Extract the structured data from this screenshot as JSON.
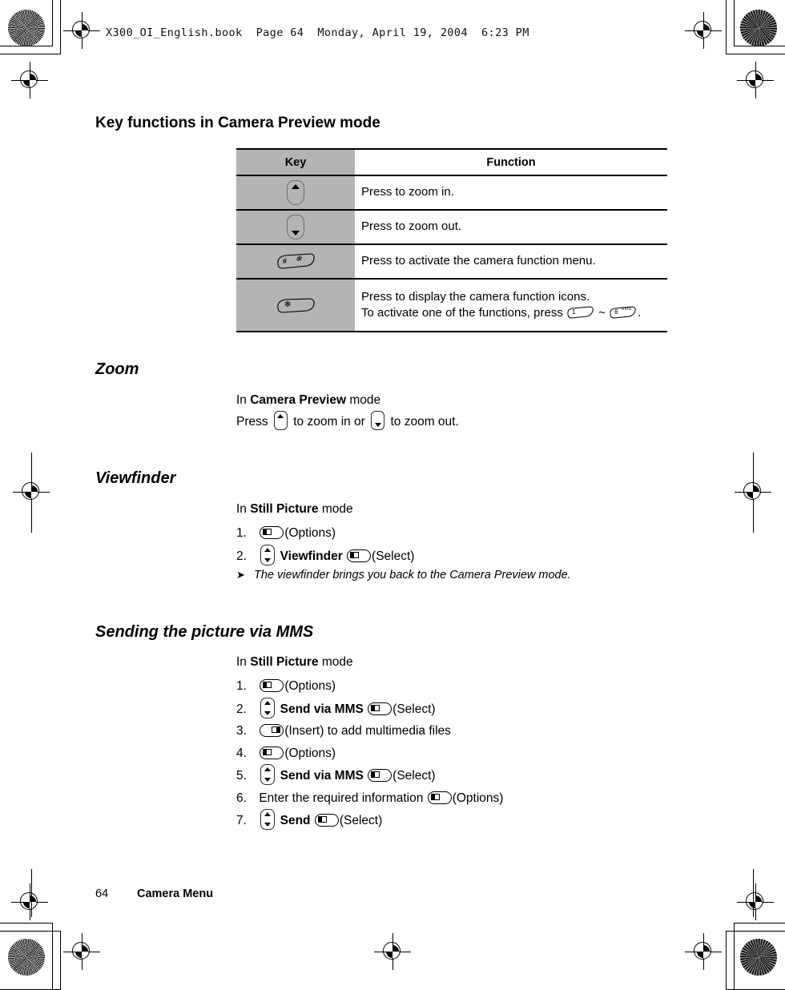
{
  "print_header": "X300_OI_English.book  Page 64  Monday, April 19, 2004  6:23 PM",
  "sections": {
    "key_functions": {
      "heading": "Key functions in Camera Preview mode",
      "table": {
        "headers": [
          "Key",
          "Function"
        ],
        "rows": [
          {
            "key_icon": "nav-up-key",
            "function": "Press to zoom in."
          },
          {
            "key_icon": "nav-down-key",
            "function": "Press to zoom out."
          },
          {
            "key_icon": "hash-key",
            "function": "Press to activate the camera function menu."
          },
          {
            "key_icon": "star-key",
            "function_line1": "Press to display the camera function icons.",
            "function_line2_before": "To activate one of the functions, press",
            "function_line2_key1": "1",
            "function_line2_tilde": "~",
            "function_line2_key2": "6",
            "function_line2_key2_sub": "mno",
            "function_line2_after": "."
          }
        ]
      }
    },
    "zoom": {
      "heading": "Zoom",
      "mode_prefix": "In ",
      "mode_bold": "Camera Preview",
      "mode_suffix": " mode",
      "instruction_a": "Press",
      "instruction_b": "to zoom in or",
      "instruction_c": "to zoom out."
    },
    "viewfinder": {
      "heading": "Viewfinder",
      "mode_prefix": "In ",
      "mode_bold": "Still Picture",
      "mode_suffix": " mode",
      "steps": [
        {
          "num": "1.",
          "softkey": "left",
          "label": "(Options)"
        },
        {
          "num": "2.",
          "nav": true,
          "bold": "Viewfinder",
          "softkey": "left",
          "label": "(Select)"
        }
      ],
      "note": "The viewfinder brings you back to the Camera Preview mode."
    },
    "mms": {
      "heading": "Sending the picture via MMS",
      "mode_prefix": "In ",
      "mode_bold": "Still Picture",
      "mode_suffix": " mode",
      "steps": [
        {
          "num": "1.",
          "softkey": "left",
          "label": "(Options)"
        },
        {
          "num": "2.",
          "nav": true,
          "bold": "Send via MMS",
          "softkey": "left",
          "label": "(Select)"
        },
        {
          "num": "3.",
          "softkey": "right",
          "label": "(Insert) to add multimedia files"
        },
        {
          "num": "4.",
          "softkey": "left",
          "label": "(Options)"
        },
        {
          "num": "5.",
          "nav": true,
          "bold": "Send via MMS",
          "softkey": "left",
          "label": "(Select)"
        },
        {
          "num": "6.",
          "text_before": "Enter the required information",
          "softkey": "left",
          "label": "(Options)"
        },
        {
          "num": "7.",
          "nav": true,
          "bold": "Send",
          "softkey": "left",
          "label": "(Select)"
        }
      ]
    }
  },
  "footer": {
    "page_number": "64",
    "chapter": "Camera Menu"
  },
  "colors": {
    "table_key_cell": "#b4b4b4",
    "rule": "#000000",
    "page_background": "#ffffff"
  }
}
